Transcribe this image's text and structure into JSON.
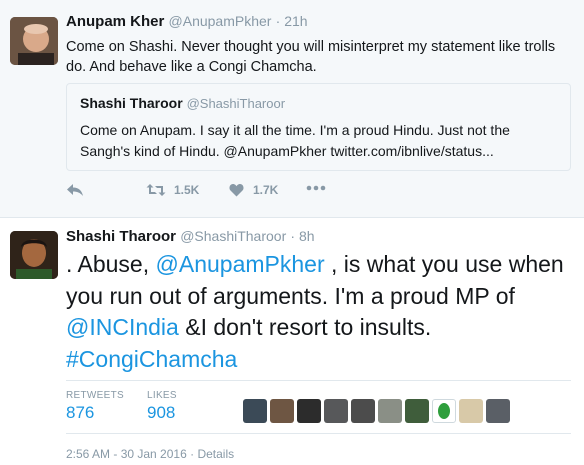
{
  "tweet1": {
    "name": "Anupam Kher",
    "handle": "@AnupamPkher",
    "time": "21h",
    "text": "Come on Shashi. Never thought you will misinterpret my statement like trolls do. And behave like a Congi Chamcha.",
    "quote": {
      "name": "Shashi Tharoor",
      "handle": "@ShashiTharoor",
      "text": "Come on Anupam. I say it all the time. I'm a  proud Hindu. Just not the Sangh's kind of Hindu. @AnupamPkher  twitter.com/ibnlive/status..."
    },
    "actions": {
      "reply_icon": "reply-icon",
      "retweet_icon": "retweet-icon",
      "retweets": "1.5K",
      "like_icon": "heart-icon",
      "likes": "1.7K",
      "more_icon": "more-icon"
    }
  },
  "tweet2": {
    "name": "Shashi Tharoor",
    "handle": "@ShashiTharoor",
    "time": "8h",
    "text_parts": {
      "p1": ". Abuse, ",
      "mention1": "@AnupamPkher",
      "p2": " , is what you use when you run out of arguments. I'm a proud MP of ",
      "mention2": "@INCIndia",
      "p3": " &I don't resort to insults. ",
      "hashtag": "#CongiChamcha"
    },
    "stats": {
      "retweets_label": "RETWEETS",
      "retweets": "876",
      "likes_label": "LIKES",
      "likes": "908"
    },
    "timestamp": "2:56 AM - 30 Jan 2016",
    "details": "Details"
  },
  "colors": {
    "link": "#1b95e0",
    "muted": "#8899a6",
    "like_retweet_bg": "#f5f8fa"
  }
}
